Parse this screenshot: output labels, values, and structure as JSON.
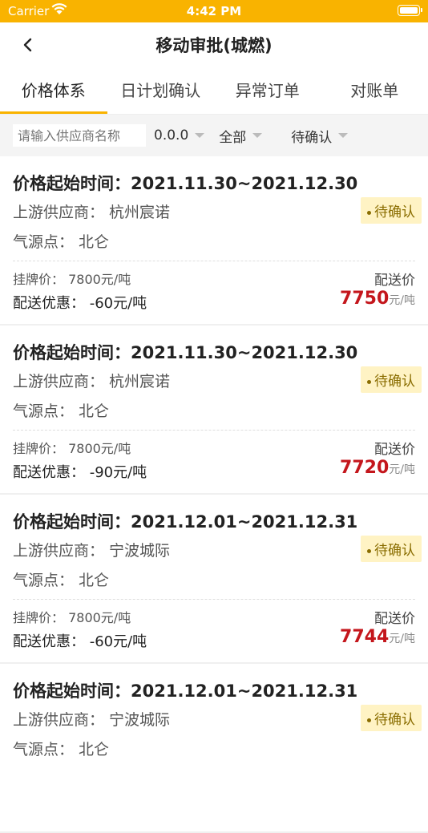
{
  "status_bar": {
    "carrier": "Carrier",
    "time": "4:42 PM"
  },
  "nav": {
    "title": "移动审批(城燃)"
  },
  "tabs": [
    {
      "label": "价格体系",
      "active": true
    },
    {
      "label": "日计划确认",
      "active": false
    },
    {
      "label": "异常订单",
      "active": false
    },
    {
      "label": "对账单",
      "active": false
    }
  ],
  "filters": {
    "search_placeholder": "请输入供应商名称",
    "price": "0.0.0",
    "scope": "全部",
    "status": "待确认"
  },
  "cards": [
    {
      "start_time": "价格起始时间：2021.11.30~2021.12.30",
      "supplier": "上游供应商：  杭州宸诺",
      "status": "待确认",
      "gas_source": "气源点：  北仑",
      "listed_price": "挂牌价：  7800元/吨",
      "discount": "配送优惠：  -60元/吨",
      "delivery_label": "配送价",
      "delivery_price": "7750",
      "delivery_unit": "元/吨"
    },
    {
      "start_time": "价格起始时间：2021.11.30~2021.12.30",
      "supplier": "上游供应商：  杭州宸诺",
      "status": "待确认",
      "gas_source": "气源点：  北仑",
      "listed_price": "挂牌价：  7800元/吨",
      "discount": "配送优惠：  -90元/吨",
      "delivery_label": "配送价",
      "delivery_price": "7720",
      "delivery_unit": "元/吨"
    },
    {
      "start_time": "价格起始时间：2021.12.01~2021.12.31",
      "supplier": "上游供应商：  宁波城际",
      "status": "待确认",
      "gas_source": "气源点：  北仑",
      "listed_price": "挂牌价：  7800元/吨",
      "discount": "配送优惠：  -60元/吨",
      "delivery_label": "配送价",
      "delivery_price": "7744",
      "delivery_unit": "元/吨"
    },
    {
      "start_time": "价格起始时间：2021.12.01~2021.12.31",
      "supplier": "上游供应商：  宁波城际",
      "status": "待确认",
      "gas_source": "气源点：  北仑"
    }
  ],
  "colors": {
    "accent": "#F9B300",
    "price_red": "#C4161C",
    "badge_bg": "#FFF3C4"
  }
}
